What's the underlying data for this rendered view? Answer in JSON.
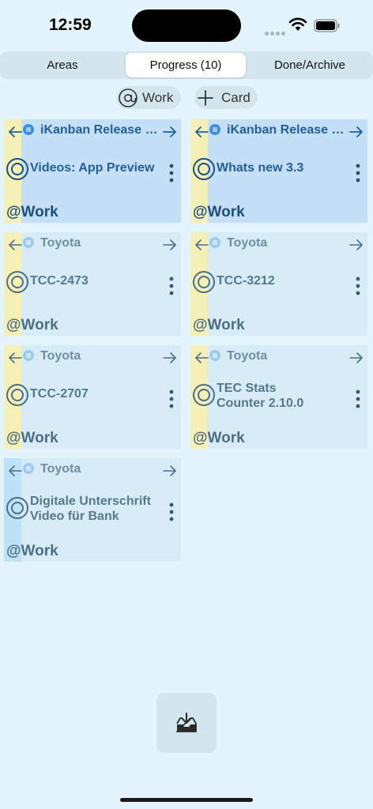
{
  "status_bar": {
    "time": "12:59"
  },
  "tabs": [
    {
      "label": "Areas",
      "active": false
    },
    {
      "label": "Progress (10)",
      "active": true
    },
    {
      "label": "Done/Archive",
      "active": false
    }
  ],
  "toolbar": {
    "context_label": "Work",
    "card_label": "Card"
  },
  "cards": [
    {
      "area": "iKanban Release 3...",
      "title": "Videos: App Preview",
      "context": "@Work",
      "highlight": true,
      "stripe": "yellow"
    },
    {
      "area": "iKanban Release 3...",
      "title": "Whats new 3.3",
      "context": "@Work",
      "highlight": true,
      "stripe": "yellow"
    },
    {
      "area": "Toyota",
      "title": "TCC-2473",
      "context": "@Work",
      "highlight": false,
      "stripe": "yellow"
    },
    {
      "area": "Toyota",
      "title": "TCC-3212",
      "context": "@Work",
      "highlight": false,
      "stripe": "yellow"
    },
    {
      "area": "Toyota",
      "title": "TCC-2707",
      "context": "@Work",
      "highlight": false,
      "stripe": "yellow"
    },
    {
      "area": "Toyota",
      "title": "TEC Stats Counter 2.10.0",
      "context": "@Work",
      "highlight": false,
      "stripe": "yellow"
    },
    {
      "area": "Toyota",
      "title": "Digitale Unterschrift Video für Bank",
      "context": "@Work",
      "highlight": false,
      "stripe": "blue"
    }
  ],
  "colors": {
    "background": "#e3f4fc",
    "accent": "#1f5f9a",
    "stripe_yellow": "#f5f1b6",
    "stripe_blue": "#bfe2f7"
  },
  "icons": {
    "wifi": "wifi-icon",
    "battery": "battery-icon",
    "at": "at-icon",
    "plus": "plus-icon",
    "inbox": "inbox-download-icon"
  }
}
